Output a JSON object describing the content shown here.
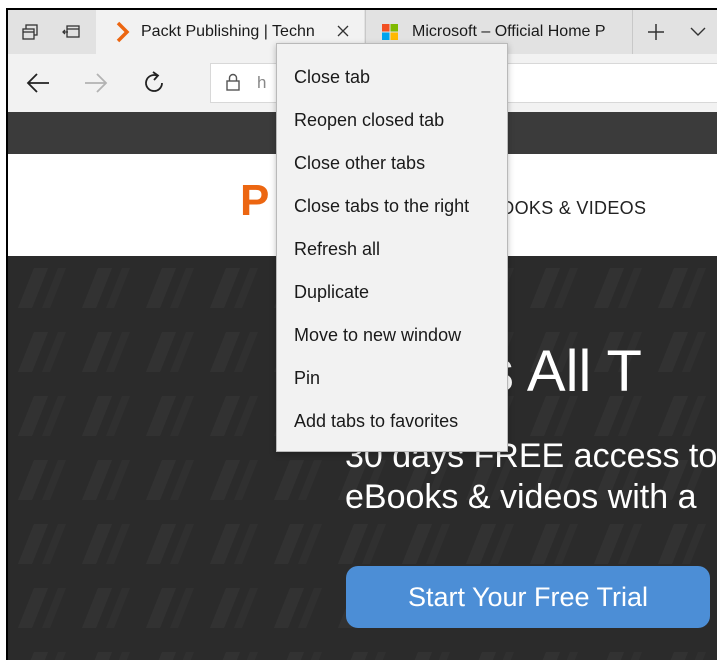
{
  "browser": {
    "tabs": [
      {
        "label": "Packt Publishing | Techn",
        "icon": "packt-favicon",
        "active": true
      },
      {
        "label": "Microsoft – Official Home P",
        "icon": "microsoft-favicon",
        "active": false
      }
    ],
    "strip_buttons": [
      "set-tabs-aside-icon",
      "show-tabs-aside-icon"
    ],
    "new_tab_icon": "plus-icon",
    "tab_list_icon": "chevron-down-icon",
    "nav": {
      "back_icon": "back-arrow-icon",
      "forward_icon": "forward-arrow-icon",
      "refresh_icon": "refresh-icon"
    },
    "address": {
      "value": "h",
      "icon": "lock-icon"
    }
  },
  "context_menu": {
    "items": [
      "Close tab",
      "Reopen closed tab",
      "Close other tabs",
      "Close tabs to the right",
      "Refresh all",
      "Duplicate",
      "Move to new window",
      "Pin",
      "Add tabs to favorites"
    ]
  },
  "website": {
    "logo": "P",
    "nav_link": "BOOKS & VIDEOS",
    "hero": {
      "title": "ss All T",
      "subtitle_line1": "30 days FREE access to",
      "subtitle_line2": "eBooks & videos with a"
    },
    "cta_label": "Start Your Free Trial"
  },
  "colors": {
    "accent_orange": "#ec6611",
    "cta_blue": "#4c8ed6",
    "hero_bg": "#2b2b2b",
    "topbar_bg": "#3b3b3b"
  }
}
